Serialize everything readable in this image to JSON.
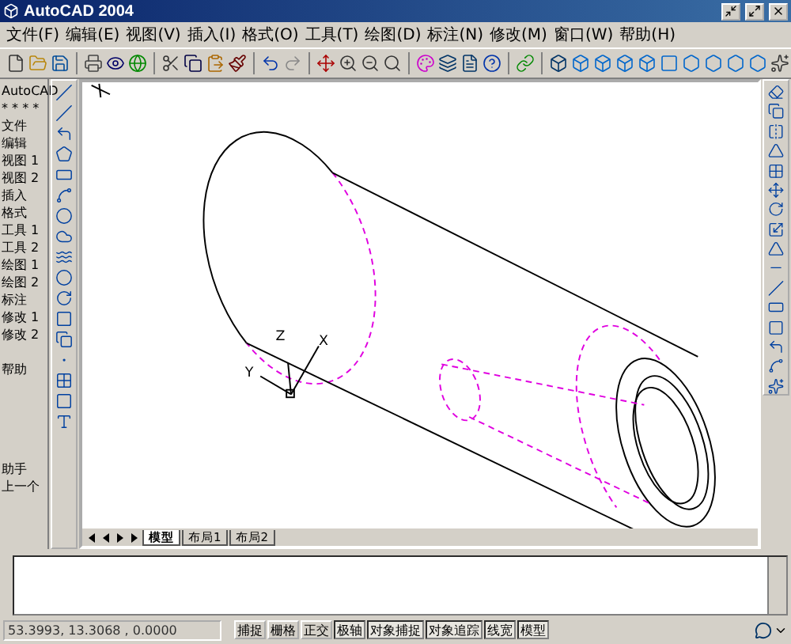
{
  "window": {
    "title": "AutoCAD 2004"
  },
  "menu": [
    "文件(F)",
    "编辑(E)",
    "视图(V)",
    "插入(I)",
    "格式(O)",
    "工具(T)",
    "绘图(D)",
    "标注(N)",
    "修改(M)",
    "窗口(W)",
    "帮助(H)"
  ],
  "screen_menu": {
    "header": "AutoCAD",
    "stars": "* * * *",
    "items": [
      "文件",
      "编辑",
      "视图 1",
      "视图 2",
      "插入",
      "格式",
      "工具 1",
      "工具 2",
      "绘图 1",
      "绘图 2",
      "标注",
      "修改 1",
      "修改 2"
    ],
    "help": "帮助",
    "bottom": [
      "助手",
      "上一个"
    ]
  },
  "ucs": {
    "x": "X",
    "y": "Y",
    "z": "Z"
  },
  "layout_tabs": [
    {
      "label": "模型",
      "selected": true
    },
    {
      "label": "布局1",
      "selected": false
    },
    {
      "label": "布局2",
      "selected": false
    }
  ],
  "status_bar": {
    "coordinates": "53.3993,  13.3068 , 0.0000",
    "toggles": [
      {
        "label": "捕捉",
        "on": false
      },
      {
        "label": "栅格",
        "on": false
      },
      {
        "label": "正交",
        "on": false
      },
      {
        "label": "极轴",
        "on": true
      },
      {
        "label": "对象捕捉",
        "on": true
      },
      {
        "label": "对象追踪",
        "on": true
      },
      {
        "label": "线宽",
        "on": true
      },
      {
        "label": "模型",
        "on": true
      }
    ]
  }
}
